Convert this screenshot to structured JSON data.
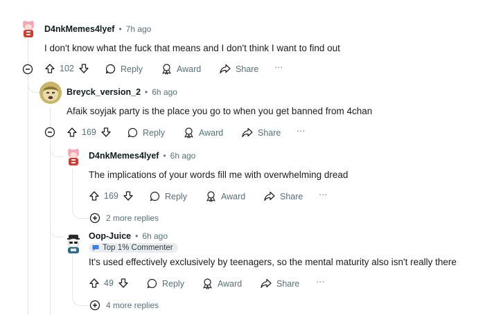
{
  "comments": [
    {
      "username": "D4nkMemes4lyef",
      "dot": "•",
      "time": "7h ago",
      "body": "I don't know what the fuck that means and I don't think I want to find out",
      "votes": "102",
      "reply": "Reply",
      "award": "Award",
      "share": "Share",
      "more": "···"
    },
    {
      "username": "Breyck_version_2",
      "dot": "•",
      "time": "6h ago",
      "body": "Afaik soyjak party is the place you go to when you get banned from 4chan",
      "votes": "169",
      "reply": "Reply",
      "award": "Award",
      "share": "Share",
      "more": "···"
    },
    {
      "username": "D4nkMemes4lyef",
      "dot": "•",
      "time": "6h ago",
      "body": "The implications of your words fill me with overwhelming dread",
      "votes": "169",
      "reply": "Reply",
      "award": "Award",
      "share": "Share",
      "more": "···",
      "more_replies": "2 more replies"
    },
    {
      "username": "Oop-Juice",
      "dot": "•",
      "time": "6h ago",
      "flair": "Top 1% Commenter",
      "body": "It's used effectively exclusively by teenagers, so the mental maturity also isn't really there",
      "votes": "49",
      "reply": "Reply",
      "award": "Award",
      "share": "Share",
      "more": "···",
      "more_replies": "4 more replies"
    }
  ],
  "icons": {
    "collapse": "collapse-icon",
    "upvote": "upvote-icon",
    "downvote": "downvote-icon",
    "reply": "reply-icon",
    "award": "award-icon",
    "share": "share-icon",
    "expand": "expand-icon"
  },
  "colors": {
    "meta_gray": "#576f76",
    "thread_line": "#e3e6e8",
    "flair_bg": "#eaedef"
  }
}
